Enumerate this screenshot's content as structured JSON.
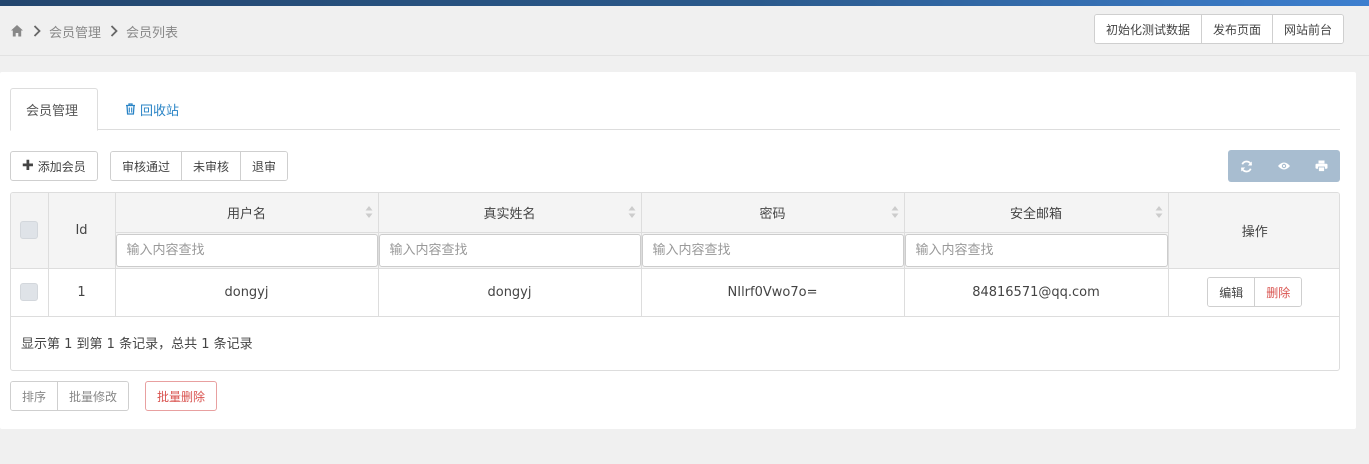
{
  "breadcrumb": {
    "items": [
      "会员管理",
      "会员列表"
    ]
  },
  "header_actions": [
    "初始化测试数据",
    "发布页面",
    "网站前台"
  ],
  "tabs": {
    "active": "会员管理",
    "recycle": "回收站"
  },
  "toolbar": {
    "add_member": "添加会员",
    "status_buttons": [
      "审核通过",
      "未审核",
      "退审"
    ]
  },
  "table": {
    "columns": {
      "id": "Id",
      "username": "用户名",
      "realname": "真实姓名",
      "password": "密码",
      "email": "安全邮箱",
      "actions": "操作"
    },
    "filter_placeholder": "输入内容查找",
    "rows": [
      {
        "id": "1",
        "username": "dongyj",
        "realname": "dongyj",
        "password": "NIlrf0Vwo7o=",
        "email": "84816571@qq.com",
        "edit": "编辑",
        "delete": "删除"
      }
    ],
    "summary": "显示第 1 到第 1 条记录，总共 1 条记录"
  },
  "bottom": {
    "sort": "排序",
    "batch_edit": "批量修改",
    "batch_delete": "批量删除"
  },
  "colors": {
    "accent": "#2a84c6",
    "danger": "#d9534f",
    "tool_bg": "#a8bdd0"
  }
}
